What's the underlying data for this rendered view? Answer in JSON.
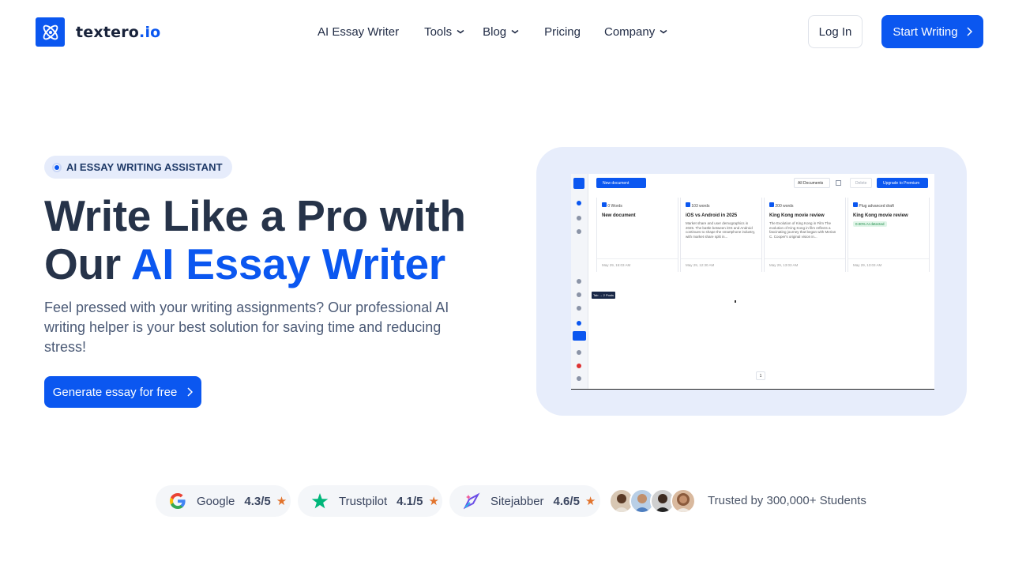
{
  "brand": {
    "name_main": "textero",
    "name_tld": ".io",
    "accent_color": "#0b57f0",
    "logo_icon": "atom-icon"
  },
  "nav": {
    "items": [
      {
        "label": "AI Essay Writer",
        "has_dropdown": false
      },
      {
        "label": "Tools",
        "has_dropdown": true
      },
      {
        "label": "Blog",
        "has_dropdown": true
      },
      {
        "label": "Pricing",
        "has_dropdown": false
      },
      {
        "label": "Company",
        "has_dropdown": true
      }
    ],
    "login_label": "Log In",
    "start_label": "Start Writing"
  },
  "hero": {
    "badge": "AI ESSAY WRITING ASSISTANT",
    "headline_line1": "Write Like a Pro with",
    "headline_line2_plain": "Our ",
    "headline_line2_accent": "AI Essay Writer",
    "subtext": "Feel pressed with your writing assignments? Our professional AI writing helper is your best solution for saving time and reducing stress!",
    "cta_label": "Generate essay for free"
  },
  "preview": {
    "new_doc": "New document",
    "filter": "All Documents",
    "delete": "Delete",
    "upgrade": "Upgrade to Premium",
    "tooltip": "Tab → 2 Posts",
    "page": "1",
    "cards": [
      {
        "tag": "0 Words",
        "title": "New document",
        "body": "",
        "ai": "",
        "date": "May 29, 15:03 AM"
      },
      {
        "tag": "103 words",
        "title": "iOS vs Android in 2025",
        "body": "Market share and user demographics in 2025. The battle between iOS and Android continues to shape the smartphone industry, with market share split in...",
        "ai": "",
        "date": "May 29, 12:30 AM"
      },
      {
        "tag": "200 words",
        "title": "King Kong movie review",
        "body": "The Evolution of King Kong in Film The evolution of King Kong in film reflects a fascinating journey that began with Merian C. Cooper's original vision in...",
        "ai": "",
        "date": "May 29, 13:03 AM"
      },
      {
        "tag": "Plug advanced draft",
        "title": "King Kong movie review",
        "body": "",
        "ai": "0.00% AI detected",
        "date": "May 29, 13:03 AM"
      }
    ]
  },
  "trust": {
    "ratings": [
      {
        "name": "Google",
        "score": "4.3/5",
        "icon": "google-icon"
      },
      {
        "name": "Trustpilot",
        "score": "4.1/5",
        "icon": "trustpilot-star-icon"
      },
      {
        "name": "Sitejabber",
        "score": "4.6/5",
        "icon": "sitejabber-icon"
      }
    ],
    "star": "★",
    "trusted_text": "Trusted by 300,000+ Students"
  }
}
